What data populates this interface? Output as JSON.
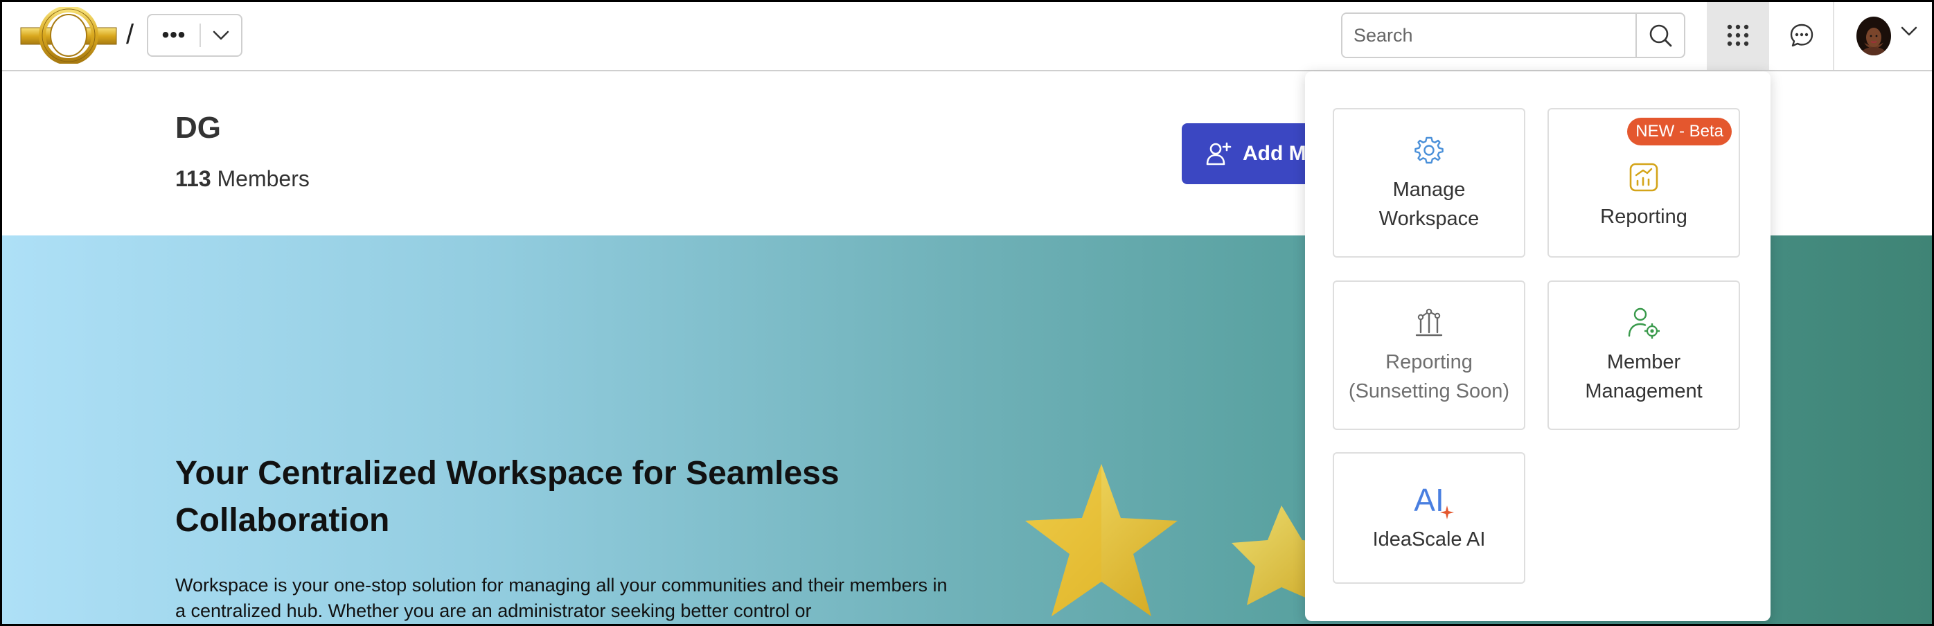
{
  "topbar": {
    "breadcrumb_separator": "/",
    "breadcrumb_more": "•••",
    "search_placeholder": "Search"
  },
  "workspace": {
    "title": "DG",
    "member_count": "113",
    "member_label": "Members",
    "add_button_label": "Add Me"
  },
  "hero": {
    "title": "Your Centralized Workspace for Seamless Collaboration",
    "text": "Workspace is your one-stop solution for managing all your communities and their members in a centralized hub. Whether you are an administrator seeking better control or"
  },
  "apps_menu": {
    "tiles": [
      {
        "label": "Manage\nWorkspace",
        "icon": "gear-icon"
      },
      {
        "label": "Reporting",
        "icon": "chart-icon",
        "badge": "NEW - Beta"
      },
      {
        "label": "Reporting\n(Sunsetting Soon)",
        "icon": "metrics-icon"
      },
      {
        "label": "Member\nManagement",
        "icon": "user-settings-icon"
      },
      {
        "label": "IdeaScale AI",
        "icon": "ai-icon",
        "icon_text": "AI"
      }
    ]
  },
  "colors": {
    "primary_button": "#3b47c2",
    "badge": "#e4572e",
    "hero_gradient_start": "#aee0f7",
    "hero_gradient_end": "#3f8475"
  }
}
